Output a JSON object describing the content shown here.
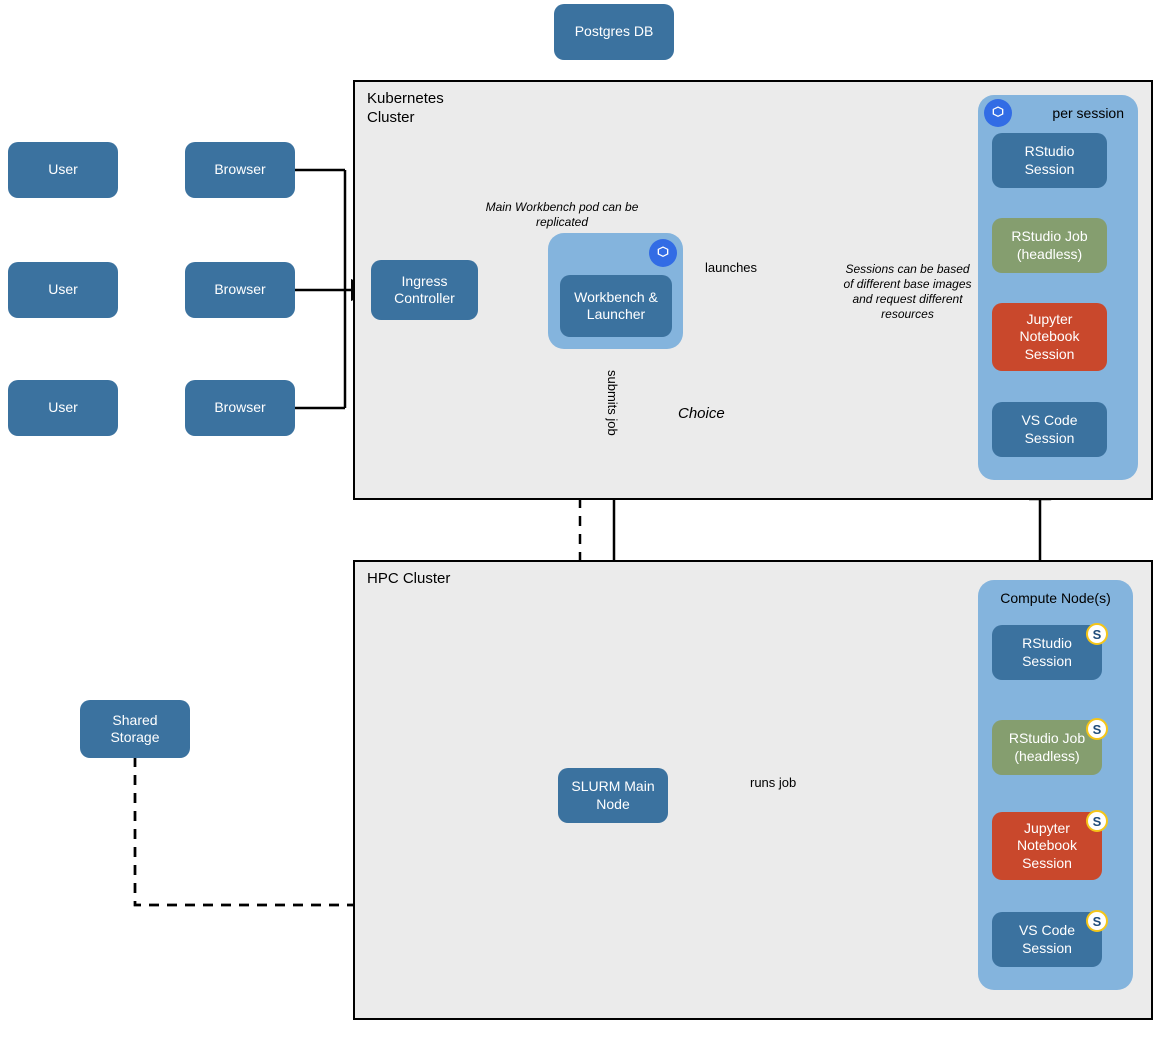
{
  "nodes": {
    "postgres": "Postgres DB",
    "user": "User",
    "browser": "Browser",
    "shared_storage": "Shared Storage",
    "ingress": "Ingress Controller",
    "workbench": "Workbench & Launcher",
    "slurm": "SLURM Main Node"
  },
  "clusters": {
    "k8s": "Kubernetes\nCluster",
    "hpc": "HPC Cluster"
  },
  "pods": {
    "per_session": "per session",
    "compute_nodes": "Compute Node(s)"
  },
  "sessions": {
    "rstudio": "RStudio Session",
    "rstudio_job": "RStudio Job (headless)",
    "jupyter": "Jupyter Notebook Session",
    "vscode": "VS Code Session"
  },
  "captions": {
    "replicated": "Main Workbench pod can be replicated",
    "base_images": "Sessions can be based of different base images and request different resources"
  },
  "edge_labels": {
    "launches": "launches",
    "submits_job": "submits job",
    "choice": "Choice",
    "runs_job": "runs job"
  },
  "icons": {
    "pod": "pod-icon",
    "singularity": "singularity-icon"
  }
}
